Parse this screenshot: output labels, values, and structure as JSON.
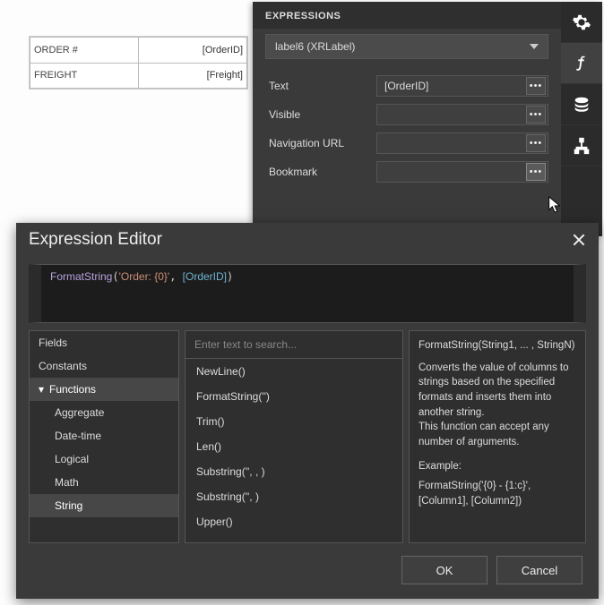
{
  "design_table": {
    "rows": [
      {
        "label": "ORDER #",
        "binding": "[OrderID]"
      },
      {
        "label": "FREIGHT",
        "binding": "[Freight]"
      }
    ]
  },
  "expressions_panel": {
    "title": "EXPRESSIONS",
    "target": "label6 (XRLabel)",
    "properties": [
      {
        "name": "Text",
        "value": "[OrderID]"
      },
      {
        "name": "Visible",
        "value": ""
      },
      {
        "name": "Navigation URL",
        "value": ""
      },
      {
        "name": "Bookmark",
        "value": ""
      }
    ]
  },
  "side_tabs": [
    {
      "id": "settings",
      "active": false
    },
    {
      "id": "expressions",
      "active": true
    },
    {
      "id": "data",
      "active": false
    },
    {
      "id": "report-tree",
      "active": false
    }
  ],
  "editor": {
    "title": "Expression Editor",
    "code": {
      "fn": "FormatString",
      "arg_str": "'Order: {0}'",
      "arg_col": "[OrderID]"
    },
    "search_placeholder": "Enter text to search...",
    "tree": {
      "top": [
        {
          "label": "Fields",
          "selected": false
        },
        {
          "label": "Constants",
          "selected": false
        },
        {
          "label": "Functions",
          "selected": true,
          "expanded": true
        }
      ],
      "functions_children": [
        {
          "label": "Aggregate",
          "selected": false
        },
        {
          "label": "Date-time",
          "selected": false
        },
        {
          "label": "Logical",
          "selected": false
        },
        {
          "label": "Math",
          "selected": false
        },
        {
          "label": "String",
          "selected": true
        }
      ]
    },
    "list": [
      "NewLine()",
      "FormatString('')",
      "Trim()",
      "Len()",
      "Substring('', , )",
      "Substring('', )",
      "Upper()"
    ],
    "description": {
      "signature": "FormatString(String1, ... , StringN)",
      "body": "Converts the value of columns to strings based on the specified formats and inserts them into another string.\nThis function can accept any number of arguments.",
      "example_label": "Example:",
      "example": "FormatString('{0} - {1:c}', [Column1], [Column2])"
    },
    "buttons": {
      "ok": "OK",
      "cancel": "Cancel"
    }
  }
}
